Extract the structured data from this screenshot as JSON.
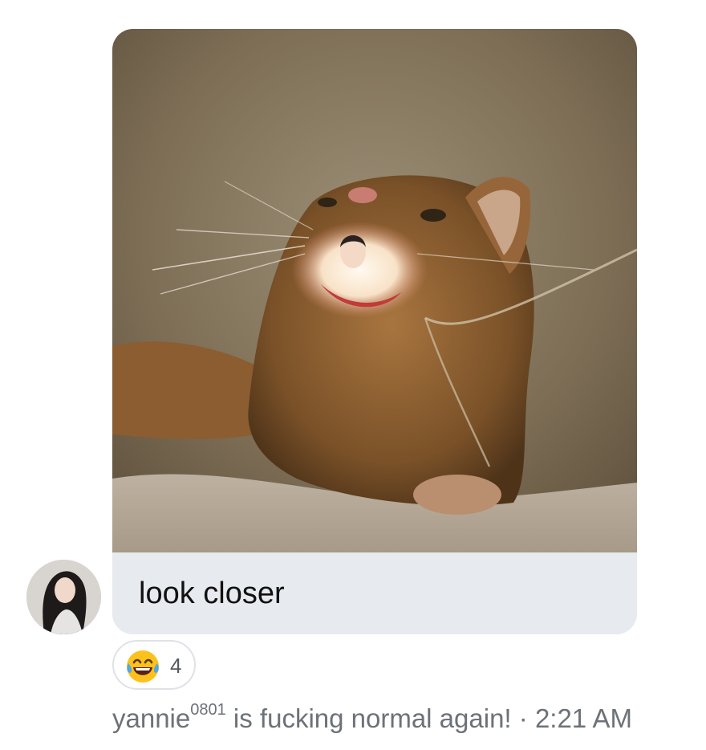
{
  "message": {
    "image_alt": "cat looking up with a face shown inside its open mouth",
    "caption": "look closer"
  },
  "sender": {
    "avatar_icon": "profile-photo"
  },
  "reaction": {
    "emoji_icon": "face-with-tears-of-joy-icon",
    "emoji": "😂",
    "count": "4"
  },
  "meta": {
    "name_base": "yannie",
    "name_super": "0801",
    "status": " is fucking normal again!",
    "separator": " · ",
    "time": "2:21 AM"
  },
  "colors": {
    "bubble_bg": "#e7eaee",
    "meta_text": "#6c7278",
    "chip_border": "#dfe2e6"
  }
}
